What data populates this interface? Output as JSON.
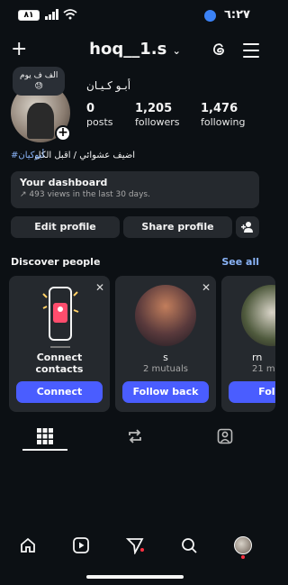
{
  "status_bar": {
    "time": "٦:٢٧",
    "battery": "٨١"
  },
  "header": {
    "username": "hoq__1.s"
  },
  "profile": {
    "note_text": "الف ف يوم",
    "note_emoji": "😓",
    "display_name": "أبـو كـيـان",
    "posts_count": "0",
    "posts_label": "posts",
    "followers_count": "1,205",
    "followers_label": "followers",
    "following_count": "1,476",
    "following_label": "following",
    "bio": "اضيف عشوائي / اقبل الكل",
    "bio_hashtag": "#أبوكيان"
  },
  "dashboard": {
    "title": "Your dashboard",
    "subtitle": "493 views in the last 30 days."
  },
  "actions": {
    "edit_label": "Edit profile",
    "share_label": "Share profile"
  },
  "discover": {
    "title": "Discover people",
    "see_all": "See all",
    "cards": [
      {
        "name": "Connect contacts",
        "button": "Connect"
      },
      {
        "name": "s",
        "subtitle": "2 mutuals",
        "button": "Follow back"
      },
      {
        "name": "rn",
        "subtitle": "21 m",
        "button": "Follo"
      }
    ]
  },
  "colors": {
    "background": "#0c1014",
    "accent": "#4a5dff",
    "link": "#8ab4f8"
  }
}
